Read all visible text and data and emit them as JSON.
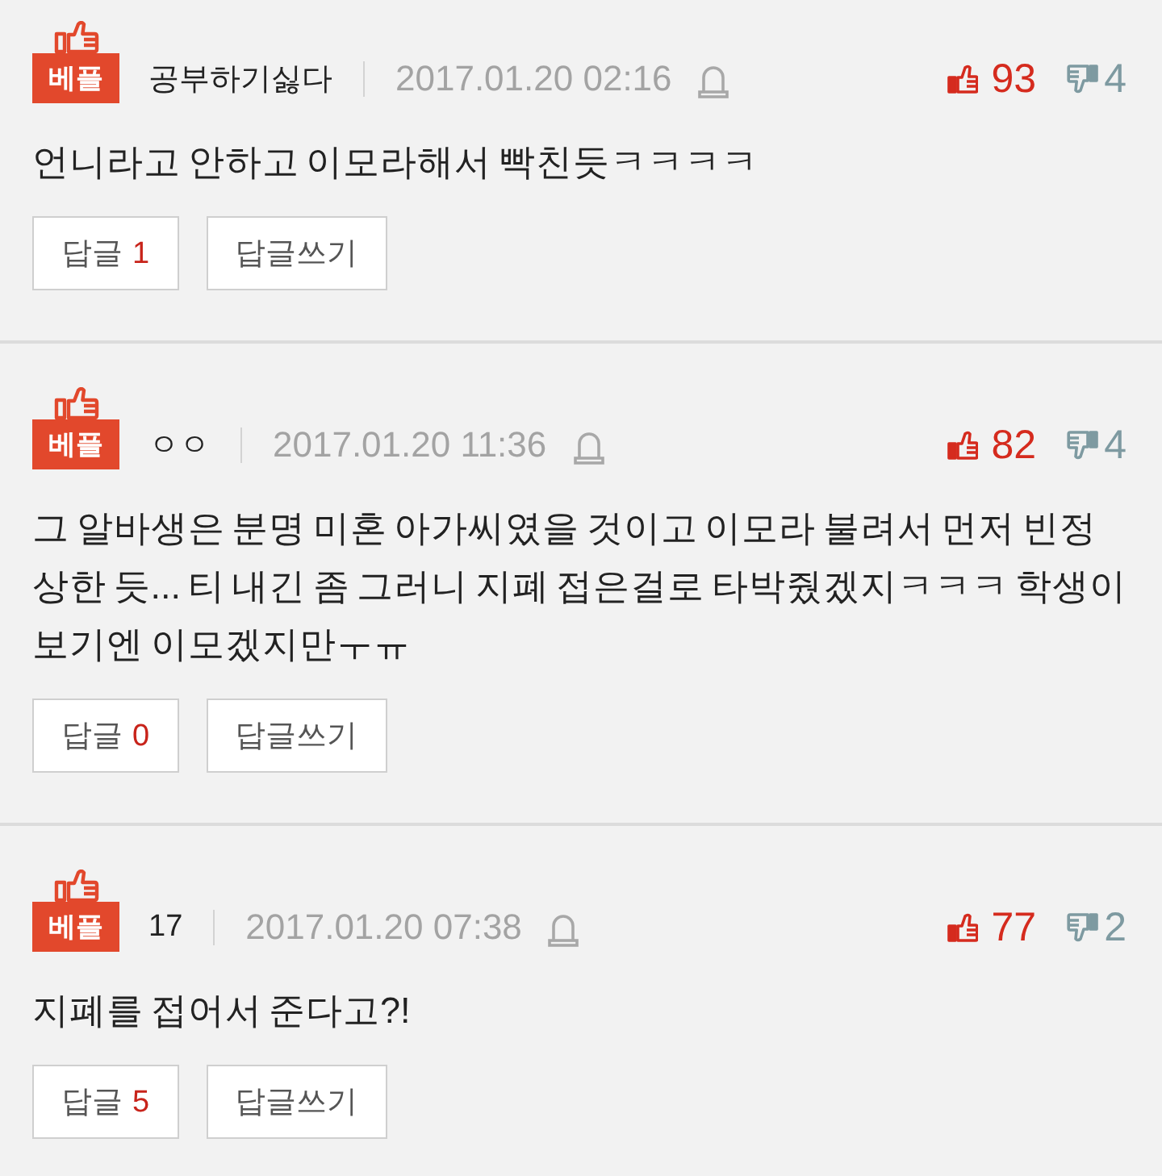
{
  "comments": [
    {
      "badge": "베플",
      "author": "공부하기싫다",
      "date": "2017.01.20 02:16",
      "likes": "93",
      "dislikes": "4",
      "text": "언니라고 안하고 이모라해서 빡친듯ㅋㅋㅋㅋ",
      "reply_button": {
        "label": "답글",
        "count": "1"
      },
      "write_reply_button": "답글쓰기"
    },
    {
      "badge": "베플",
      "author": "ㅇㅇ",
      "date": "2017.01.20 11:36",
      "likes": "82",
      "dislikes": "4",
      "text": "그 알바생은 분명 미혼 아가씨였을 것이고 이모라 불려서 먼저 빈정 상한 듯... 티 내긴 좀 그러니 지폐 접은걸로 타박줬겠지ㅋㅋㅋ 학생이 보기엔 이모겠지만ㅜㅠ",
      "reply_button": {
        "label": "답글",
        "count": "0"
      },
      "write_reply_button": "답글쓰기"
    },
    {
      "badge": "베플",
      "author": "17",
      "date": "2017.01.20 07:38",
      "likes": "77",
      "dislikes": "2",
      "text": "지폐를 접어서 준다고?!",
      "reply_button": {
        "label": "답글",
        "count": "5"
      },
      "write_reply_button": "답글쓰기"
    }
  ]
}
